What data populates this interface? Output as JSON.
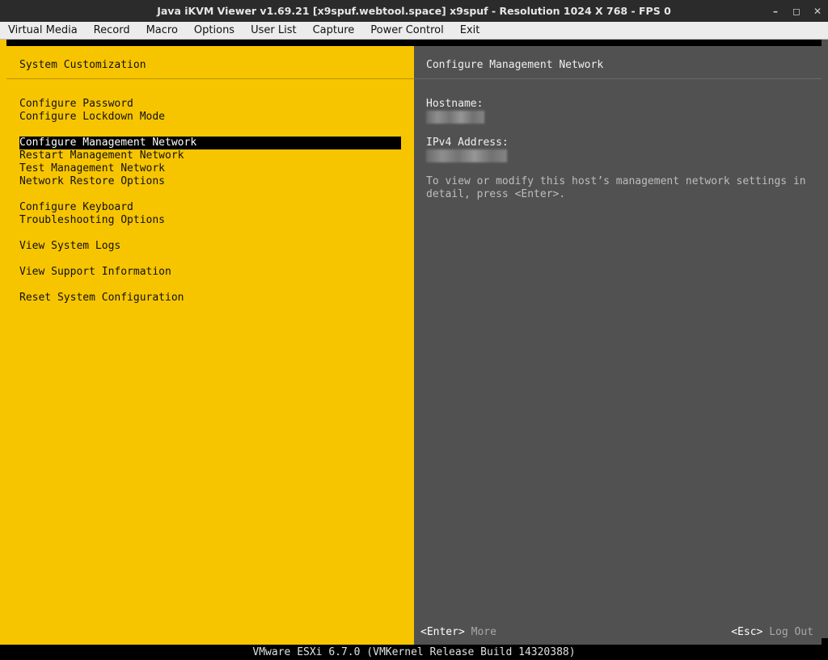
{
  "window": {
    "title": "Java iKVM Viewer v1.69.21 [x9spuf.webtool.space] x9spuf - Resolution 1024 X 768 - FPS 0",
    "controls": {
      "minimize": "–",
      "restore": "◻",
      "close": "✕"
    }
  },
  "menubar": {
    "items": [
      "Virtual Media",
      "Record",
      "Macro",
      "Options",
      "User List",
      "Capture",
      "Power Control",
      "Exit"
    ]
  },
  "left": {
    "title": "System Customization",
    "groups": [
      [
        "Configure Password",
        "Configure Lockdown Mode"
      ],
      [
        "Configure Management Network",
        "Restart Management Network",
        "Test Management Network",
        "Network Restore Options"
      ],
      [
        "Configure Keyboard",
        "Troubleshooting Options"
      ],
      [
        "View System Logs"
      ],
      [
        "View Support Information"
      ],
      [
        "Reset System Configuration"
      ]
    ],
    "selected": "Configure Management Network"
  },
  "right": {
    "title": "Configure Management Network",
    "hostname_label": "Hostname:",
    "ipv4_label": "IPv4 Address:",
    "info": "To view or modify this host’s management network settings in\ndetail, press <Enter>.",
    "footer_left_key": "<Enter>",
    "footer_left_text": "More",
    "footer_right_key": "<Esc>",
    "footer_right_text": "Log Out"
  },
  "statusbar": "VMware ESXi 6.7.0 (VMKernel Release Build 14320388)",
  "colors": {
    "left_bg": "#f7c500",
    "right_bg": "#515151",
    "selection": "#000000"
  }
}
